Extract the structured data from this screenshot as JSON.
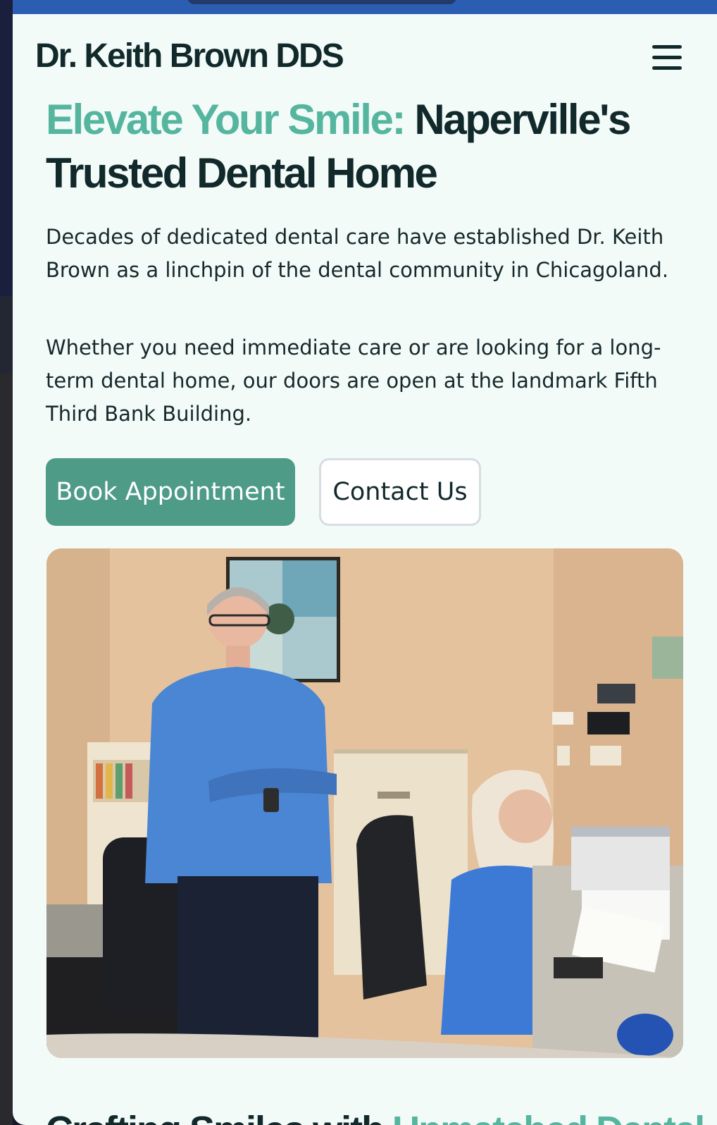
{
  "header": {
    "brand": "Dr. Keith Brown DDS",
    "menu_icon": "hamburger-menu-icon"
  },
  "hero": {
    "title_accent": "Elevate Your Smile:",
    "title_main": "Naperville's Trusted Dental Home",
    "paragraph_1": "Decades of dedicated dental care have established Dr. Keith Brown as a linchpin of the dental community in Chicagoland.",
    "paragraph_2": "Whether you need immediate care or are looking for a long-term dental home, our doors are open at the landmark Fifth Third Bank Building.",
    "primary_button": "Book Appointment",
    "secondary_button": "Contact Us"
  },
  "next_section": {
    "title_main": "Crafting Smiles with",
    "title_accent": "Unmatched Dental"
  },
  "colors": {
    "accent": "#55b59f",
    "button_primary": "#4e9b88",
    "text_dark": "#12292b",
    "page_background": "#f2fbf8",
    "browser_bar": "#2b5db2"
  }
}
